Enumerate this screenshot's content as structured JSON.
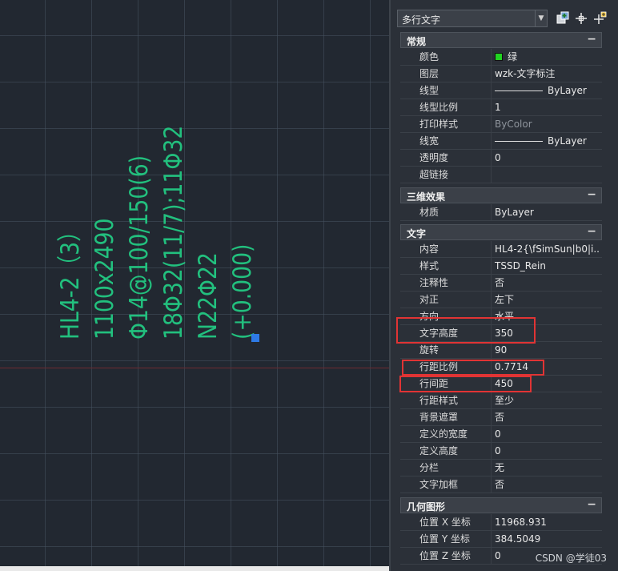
{
  "canvas": {
    "mtext_lines": [
      "HL4-2（3）",
      "1100x2490",
      "Φ14@100/150(6)",
      "18Φ32(11/7);11Φ32",
      "N22Φ22",
      "(+0.000)"
    ]
  },
  "toolbar": {
    "object_type": "多行文字",
    "icons": [
      "quick-select-icon",
      "select-objects-icon",
      "toggle-pickadd-icon"
    ]
  },
  "sections": [
    {
      "title": "常规",
      "rows": [
        {
          "label": "颜色",
          "value": "绿",
          "color": "#21d421"
        },
        {
          "label": "图层",
          "value": "wzk-文字标注"
        },
        {
          "label": "线型",
          "value": "ByLayer"
        },
        {
          "label": "线型比例",
          "value": "1"
        },
        {
          "label": "打印样式",
          "value": "ByColor"
        },
        {
          "label": "线宽",
          "value": "ByLayer"
        },
        {
          "label": "透明度",
          "value": "0"
        },
        {
          "label": "超链接",
          "value": ""
        }
      ]
    },
    {
      "title": "三维效果",
      "rows": [
        {
          "label": "材质",
          "value": "ByLayer"
        }
      ]
    },
    {
      "title": "文字",
      "rows": [
        {
          "label": "内容",
          "value": "HL4-2{\\fSimSun|b0|i..."
        },
        {
          "label": "样式",
          "value": "TSSD_Rein"
        },
        {
          "label": "注释性",
          "value": "否"
        },
        {
          "label": "对正",
          "value": "左下"
        },
        {
          "label": "方向",
          "value": "水平"
        },
        {
          "label": "文字高度",
          "value": "350"
        },
        {
          "label": "旋转",
          "value": "90"
        },
        {
          "label": "行距比例",
          "value": "0.7714"
        },
        {
          "label": "行间距",
          "value": "450"
        },
        {
          "label": "行距样式",
          "value": "至少"
        },
        {
          "label": "背景遮罩",
          "value": "否"
        },
        {
          "label": "定义的宽度",
          "value": "0"
        },
        {
          "label": "定义高度",
          "value": "0"
        },
        {
          "label": "分栏",
          "value": "无"
        },
        {
          "label": "文字加框",
          "value": "否"
        }
      ]
    },
    {
      "title": "几何图形",
      "rows": [
        {
          "label": "位置 X 坐标",
          "value": "11968.931"
        },
        {
          "label": "位置 Y 坐标",
          "value": "384.5049"
        },
        {
          "label": "位置 Z 坐标",
          "value": "0"
        }
      ]
    }
  ],
  "collapse_symbol": "−",
  "watermark": "CSDN @学徒03",
  "colors": {
    "text_green": "#22c07e",
    "highlight_red": "#e13434",
    "grip_blue": "#2e7ae6"
  }
}
